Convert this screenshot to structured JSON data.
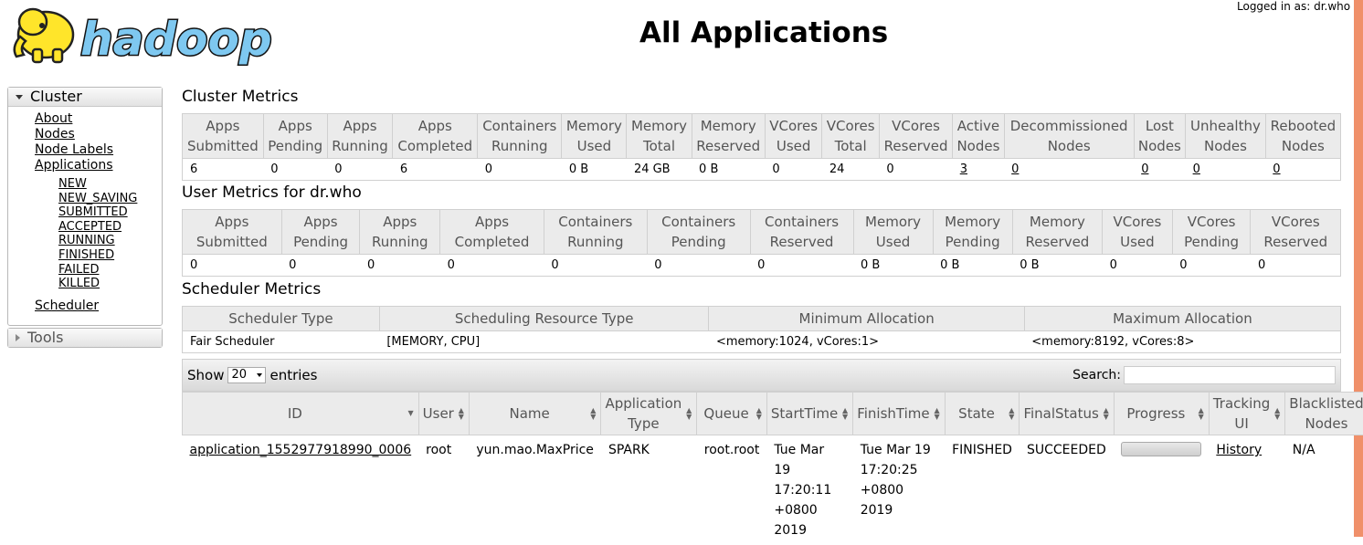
{
  "logo_text": "hadoop",
  "logged_in": "Logged in as: dr.who",
  "page_title": "All Applications",
  "sidebar": {
    "cluster_label": "Cluster",
    "links": [
      "About",
      "Nodes",
      "Node Labels",
      "Applications"
    ],
    "app_states": [
      "NEW",
      "NEW_SAVING",
      "SUBMITTED",
      "ACCEPTED",
      "RUNNING",
      "FINISHED",
      "FAILED",
      "KILLED"
    ],
    "scheduler_link": "Scheduler",
    "tools_label": "Tools"
  },
  "cluster_metrics": {
    "title": "Cluster Metrics",
    "headers": [
      [
        "Apps",
        "Submitted"
      ],
      [
        "Apps",
        "Pending"
      ],
      [
        "Apps",
        "Running"
      ],
      [
        "Apps",
        "Completed"
      ],
      [
        "Containers",
        "Running"
      ],
      [
        "Memory",
        "Used"
      ],
      [
        "Memory",
        "Total"
      ],
      [
        "Memory",
        "Reserved"
      ],
      [
        "VCores",
        "Used"
      ],
      [
        "VCores",
        "Total"
      ],
      [
        "VCores",
        "Reserved"
      ],
      [
        "Active",
        "Nodes"
      ],
      [
        "Decommissioned",
        "Nodes"
      ],
      [
        "Lost",
        "Nodes"
      ],
      [
        "Unhealthy",
        "Nodes"
      ],
      [
        "Rebooted",
        "Nodes"
      ]
    ],
    "values": [
      "6",
      "0",
      "0",
      "6",
      "0",
      "0 B",
      "24 GB",
      "0 B",
      "0",
      "24",
      "0",
      "3",
      "0",
      "0",
      "0",
      "0"
    ]
  },
  "user_metrics": {
    "title": "User Metrics for dr.who",
    "headers": [
      [
        "Apps",
        "Submitted"
      ],
      [
        "Apps",
        "Pending"
      ],
      [
        "Apps",
        "Running"
      ],
      [
        "Apps",
        "Completed"
      ],
      [
        "Containers",
        "Running"
      ],
      [
        "Containers",
        "Pending"
      ],
      [
        "Containers",
        "Reserved"
      ],
      [
        "Memory",
        "Used"
      ],
      [
        "Memory",
        "Pending"
      ],
      [
        "Memory",
        "Reserved"
      ],
      [
        "VCores",
        "Used"
      ],
      [
        "VCores",
        "Pending"
      ],
      [
        "VCores",
        "Reserved"
      ]
    ],
    "values": [
      "0",
      "0",
      "0",
      "0",
      "0",
      "0",
      "0",
      "0 B",
      "0 B",
      "0 B",
      "0",
      "0",
      "0"
    ]
  },
  "scheduler_metrics": {
    "title": "Scheduler Metrics",
    "headers": [
      "Scheduler Type",
      "Scheduling Resource Type",
      "Minimum Allocation",
      "Maximum Allocation"
    ],
    "values": [
      "Fair Scheduler",
      "[MEMORY, CPU]",
      "<memory:1024, vCores:1>",
      "<memory:8192, vCores:8>"
    ]
  },
  "apps_table": {
    "show_label": "Show",
    "page_size": "20",
    "entries_label": "entries",
    "search_label": "Search:",
    "headers": [
      [
        "ID"
      ],
      [
        "User"
      ],
      [
        "Name"
      ],
      [
        "Application",
        "Type"
      ],
      [
        "Queue"
      ],
      [
        "StartTime"
      ],
      [
        "FinishTime"
      ],
      [
        "State"
      ],
      [
        "FinalStatus"
      ],
      [
        "Progress"
      ],
      [
        "Tracking",
        "UI"
      ],
      [
        "Blacklisted",
        "Nodes"
      ]
    ],
    "rows": [
      {
        "id": "application_1552977918990_0006",
        "user": "root",
        "name": "yun.mao.MaxPrice",
        "type": "SPARK",
        "queue": "root.root",
        "start_time": [
          "Tue Mar",
          "19",
          "17:20:11",
          "+0800",
          "2019"
        ],
        "finish_time": [
          "Tue Mar 19",
          "17:20:25",
          "+0800 2019"
        ],
        "state": "FINISHED",
        "final_status": "SUCCEEDED",
        "tracking_ui": "History",
        "blacklisted": "N/A"
      }
    ]
  }
}
